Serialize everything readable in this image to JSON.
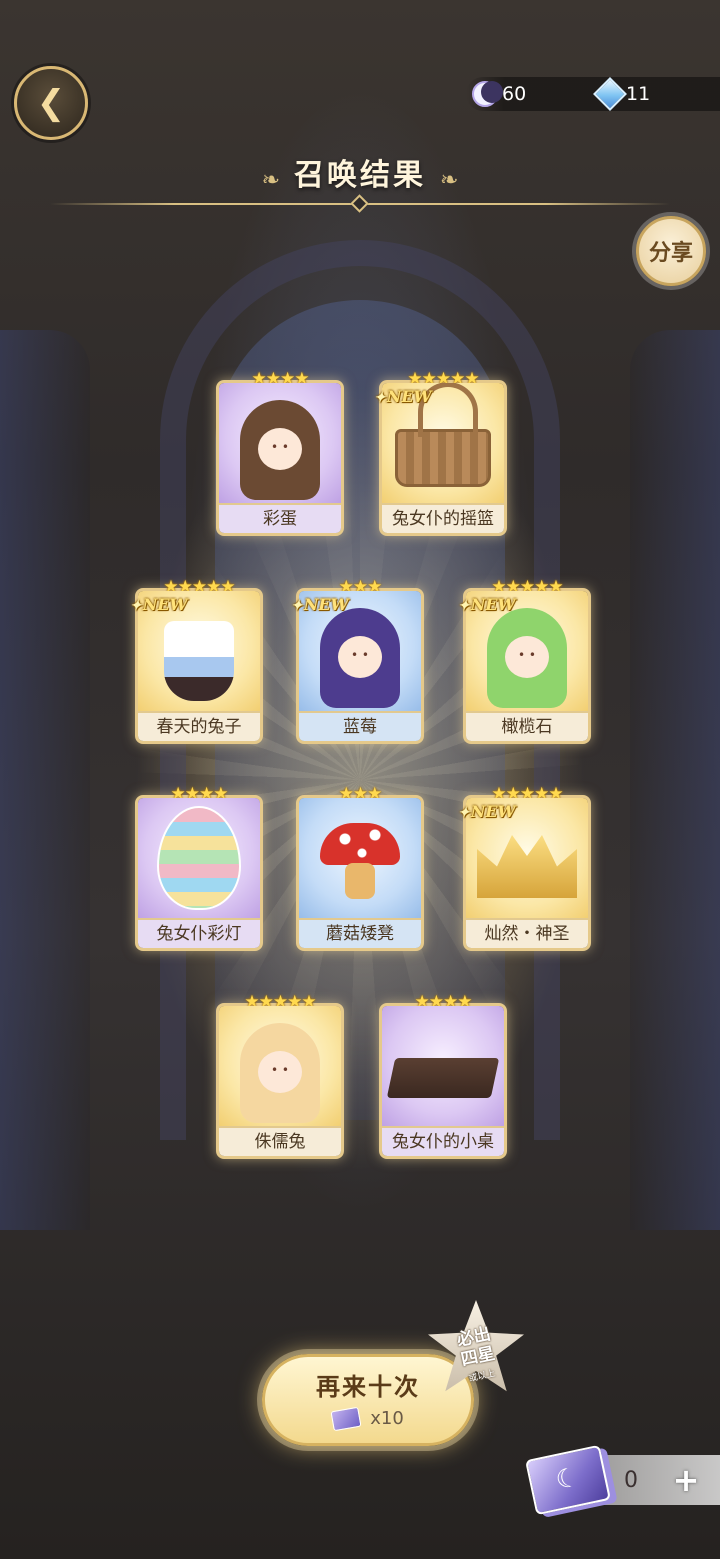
{
  "header": {
    "title": "召唤结果",
    "currencies": [
      {
        "icon": "moon-icon",
        "value": "60"
      },
      {
        "icon": "crystal-icon",
        "value": "11"
      }
    ],
    "share_label": "分享"
  },
  "cards": [
    {
      "name": "彩蛋",
      "stars": "★★★★",
      "rarity": 4,
      "new": ""
    },
    {
      "name": "兔女仆的摇篮",
      "stars": "★★★★★",
      "rarity": 5,
      "new": "NEW"
    },
    {
      "name": "春天的兔子",
      "stars": "★★★★★",
      "rarity": 5,
      "new": "NEW"
    },
    {
      "name": "蓝莓",
      "stars": "★★★",
      "rarity": 3,
      "new": "NEW"
    },
    {
      "name": "橄榄石",
      "stars": "★★★★★",
      "rarity": 5,
      "new": "NEW"
    },
    {
      "name": "兔女仆彩灯",
      "stars": "★★★★",
      "rarity": 4,
      "new": ""
    },
    {
      "name": "蘑菇矮凳",
      "stars": "★★★",
      "rarity": 3,
      "new": ""
    },
    {
      "name": "灿然・神圣",
      "stars": "★★★★★",
      "rarity": 5,
      "new": "NEW"
    },
    {
      "name": "侏儒兔",
      "stars": "★★★★★",
      "rarity": 5,
      "new": ""
    },
    {
      "name": "兔女仆的小桌",
      "stars": "★★★★",
      "rarity": 4,
      "new": ""
    }
  ],
  "footer": {
    "again_label": "再来十次",
    "cost": "x10",
    "guarantee_line1": "必出",
    "guarantee_line2": "四星",
    "guarantee_sub": "或以上",
    "ticket_count": "0",
    "plus_label": "+"
  },
  "colors": {
    "gold_border": "#e5c98a",
    "star": "#ffd94f",
    "rarity5_bg": "#fbe7a6",
    "rarity4_bg": "#dcc8f3",
    "rarity3_bg": "#c4dcf7"
  }
}
